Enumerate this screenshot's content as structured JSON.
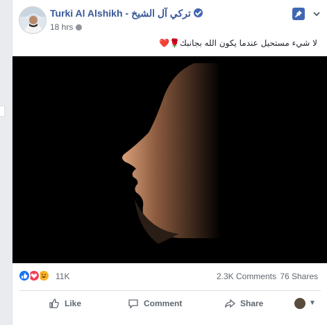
{
  "post": {
    "author_name": "Turki Al Alshikh",
    "author_name_arabic": "- تركي آل الشيخ",
    "timestamp": "18 hrs",
    "caption": "لا شيء مستحيل عندما يكون الله بجانبك🌹❤️"
  },
  "stats": {
    "reactions_count": "11K",
    "comments": "2.3K Comments",
    "shares": "76 Shares"
  },
  "actions": {
    "like_label": "Like",
    "comment_label": "Comment",
    "share_label": "Share"
  },
  "icons": [
    "verified-badge-icon",
    "globe-icon",
    "pin-icon",
    "chevron-down-icon",
    "like-reaction-icon",
    "love-reaction-icon",
    "haha-reaction-icon",
    "thumbs-up-icon",
    "comment-icon",
    "share-icon",
    "caret-down-icon"
  ],
  "colors": {
    "link_blue": "#385898",
    "accent_blue": "#4267b2",
    "text_gray": "#606770",
    "photo_bg": "#000000"
  }
}
